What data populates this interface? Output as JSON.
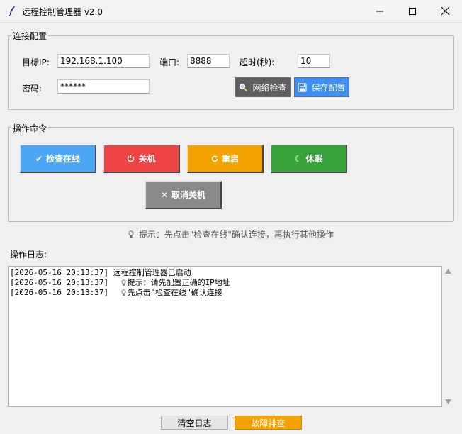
{
  "window": {
    "title": "远程控制管理器 v2.0"
  },
  "connection": {
    "group_label": "连接配置",
    "ip_label": "目标IP:",
    "ip_value": "192.168.1.100",
    "port_label": "端口:",
    "port_value": "8888",
    "timeout_label": "超时(秒):",
    "timeout_value": "10",
    "password_label": "密码:",
    "password_value": "******",
    "network_check_label": "网络检查",
    "save_config_label": "保存配置"
  },
  "commands": {
    "group_label": "操作命令",
    "check_online": "检查在线",
    "shutdown": "关机",
    "restart": "重启",
    "sleep": "休眠",
    "cancel_shutdown": "取消关机"
  },
  "hint": "提示：先点击\"检查在线\"确认连接，再执行其他操作",
  "log": {
    "label": "操作日志:",
    "lines": [
      "[2026-05-16 20:13:37] 远程控制管理器已启动",
      "[2026-05-16 20:13:37]    提示：请先配置正确的IP地址",
      "[2026-05-16 20:13:37]    先点击\"检查在线\"确认连接"
    ]
  },
  "bottom": {
    "clear_log": "清空日志",
    "troubleshoot": "故障排查"
  },
  "colors": {
    "check_online": "#4ba7f5",
    "shutdown": "#ef4444",
    "restart": "#f5a300",
    "sleep": "#37a33b",
    "cancel_shutdown": "#8a8a8a",
    "network_check": "#5f5f5f",
    "save_config": "#3d8ff5",
    "troubleshoot": "#f5a300"
  }
}
